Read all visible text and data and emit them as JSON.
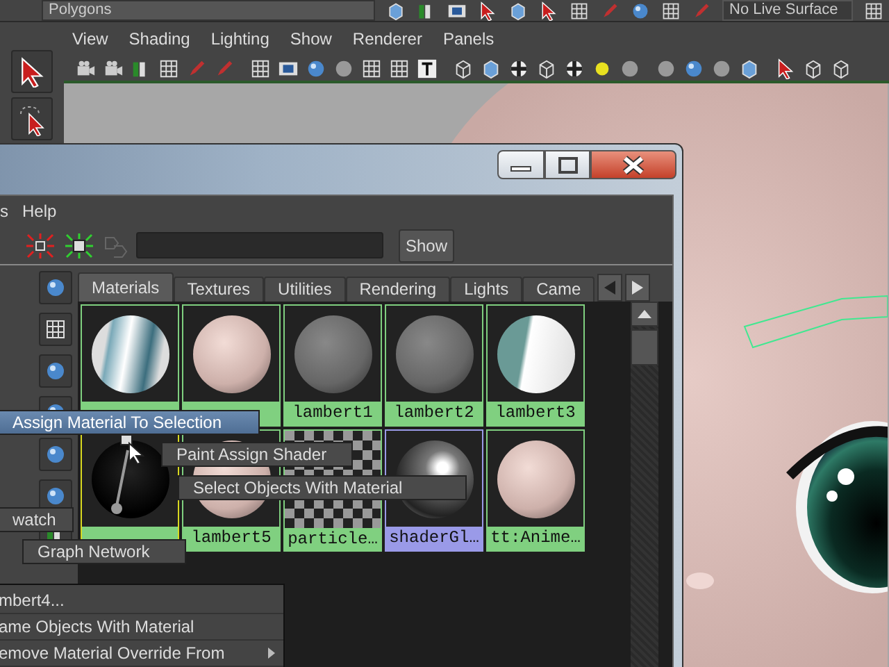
{
  "top_bar": {
    "mode_menu": "Polygons",
    "live_surface": "No Live Surface"
  },
  "viewport": {
    "menus": [
      "View",
      "Shading",
      "Lighting",
      "Show",
      "Renderer",
      "Panels"
    ]
  },
  "hypershade": {
    "menus": [
      "s",
      "Help"
    ],
    "show_button": "Show",
    "tabs": [
      {
        "label": "Materials",
        "selected": true
      },
      {
        "label": "Textures",
        "selected": false
      },
      {
        "label": "Utilities",
        "selected": false
      },
      {
        "label": "Rendering",
        "selected": false
      },
      {
        "label": "Lights",
        "selected": false
      },
      {
        "label": "Came",
        "selected": false
      }
    ],
    "swatches": [
      {
        "kind": "eye",
        "selected": false,
        "highlighted": false
      },
      {
        "kind": "pink",
        "selected": false,
        "highlighted": false
      },
      {
        "kind": "grey",
        "label": "lambert1",
        "selected": false,
        "highlighted": false
      },
      {
        "kind": "grey",
        "label": "lambert2",
        "selected": false,
        "highlighted": false
      },
      {
        "kind": "white-teal",
        "label": "lambert3",
        "selected": false,
        "highlighted": false
      },
      {
        "kind": "black",
        "selected": false,
        "highlighted": true
      },
      {
        "kind": "pink",
        "label": "lambert5",
        "selected": false,
        "highlighted": false
      },
      {
        "kind": "checker",
        "label": "particle…",
        "selected": false,
        "highlighted": false
      },
      {
        "kind": "glossy",
        "label": "shaderGl…",
        "selected": true,
        "highlighted": false
      },
      {
        "kind": "pink",
        "label": "tt:Anime…",
        "selected": false,
        "highlighted": false
      }
    ]
  },
  "marking_menu": [
    {
      "label": "Assign Material To Selection",
      "selected": true
    },
    {
      "label": "Paint Assign Shader",
      "selected": false
    },
    {
      "label": "Select Objects With Material",
      "selected": false
    },
    {
      "label": "watch",
      "selected": false
    },
    {
      "label": "Graph Network",
      "selected": false
    }
  ],
  "context_menu": [
    {
      "label": "mbert4...",
      "submenu": false
    },
    {
      "label": "ame Objects With Material",
      "submenu": false
    },
    {
      "label": "emove Material Override From",
      "submenu": true
    }
  ]
}
